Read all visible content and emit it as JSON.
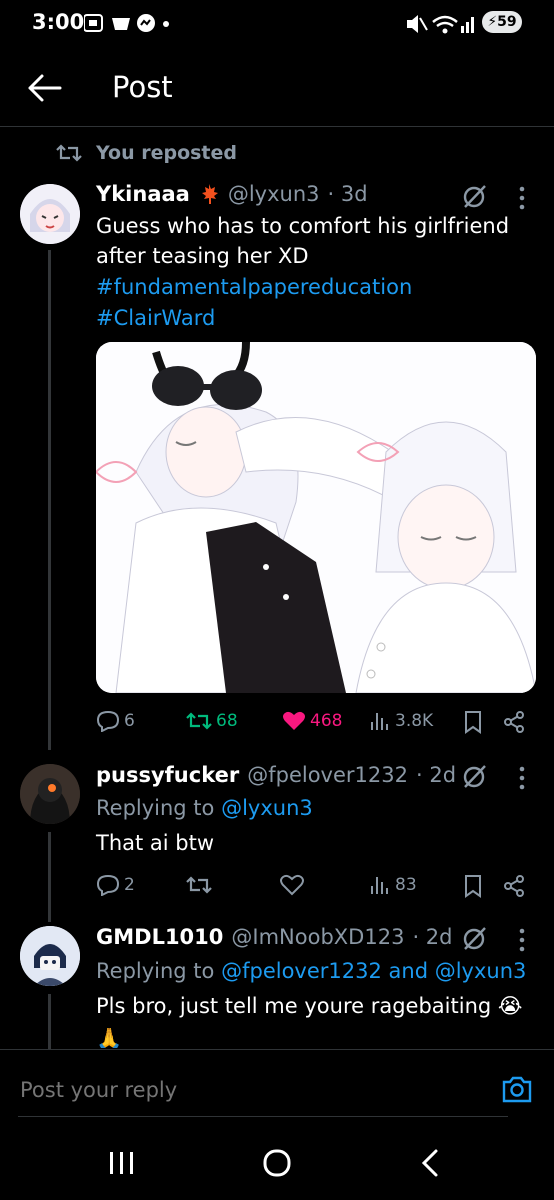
{
  "status": {
    "time": "3:00",
    "battery": "59"
  },
  "header": {
    "title": "Post"
  },
  "repost": {
    "label": "You reposted"
  },
  "post": {
    "author": "Ykinaaa",
    "handle": "@lyxun3",
    "time": "· 3d",
    "text": "Guess who has to comfort his girlfriend after teasing her XD",
    "hashtags": [
      "#fundamentalpapereducation",
      "#ClairWard"
    ],
    "stats": {
      "replies": "6",
      "reposts": "68",
      "likes": "468",
      "views": "3.8K"
    },
    "colors": {
      "repost": "#00ba7c",
      "like": "#f91880",
      "link": "#1d9bf0"
    }
  },
  "replies": [
    {
      "author": "pussyfucker",
      "handle": "@fpelover1232",
      "time": "· 2d",
      "replying_label": "Replying to",
      "replying_to": "@lyxun3",
      "text": "That ai btw",
      "stats": {
        "replies": "2",
        "reposts": "",
        "likes": "",
        "views": "83"
      }
    },
    {
      "author": "GMDL1010",
      "handle": "@ImNoobXD123",
      "time": "· 2d",
      "replying_label": "Replying to",
      "replying_to": "@fpelover1232 and @lyxun3",
      "text": "Pls bro, just tell me youre ragebaiting 😭",
      "text2": "🙏"
    }
  ],
  "composer": {
    "placeholder": "Post your reply"
  }
}
